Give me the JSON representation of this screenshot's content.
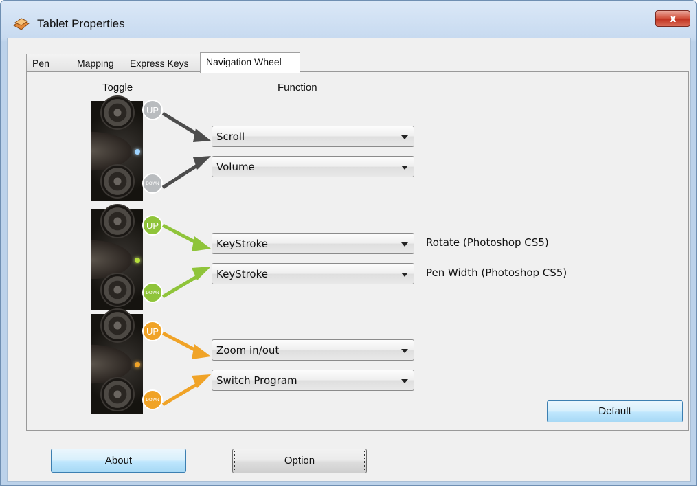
{
  "window": {
    "title": "Tablet Properties",
    "close_label": "x"
  },
  "tabs": [
    {
      "label": "Pen",
      "active": false
    },
    {
      "label": "Mapping",
      "active": false
    },
    {
      "label": "Express Keys",
      "active": false
    },
    {
      "label": "Navigation Wheel",
      "active": true
    }
  ],
  "headers": {
    "toggle": "Toggle",
    "function": "Function"
  },
  "groups": [
    {
      "color": "#b9bcbf",
      "up_label": "UP",
      "down_label": "DOWN",
      "functions": [
        {
          "value": "Scroll",
          "note": ""
        },
        {
          "value": "Volume",
          "note": ""
        }
      ]
    },
    {
      "color": "#8fc43a",
      "up_label": "UP",
      "down_label": "DOWN",
      "functions": [
        {
          "value": "KeyStroke",
          "note": "Rotate (Photoshop CS5)"
        },
        {
          "value": "KeyStroke",
          "note": "Pen Width (Photoshop CS5)"
        }
      ]
    },
    {
      "color": "#f0a327",
      "up_label": "UP",
      "down_label": "DOWN",
      "functions": [
        {
          "value": "Zoom in/out",
          "note": ""
        },
        {
          "value": "Switch Program",
          "note": ""
        }
      ]
    }
  ],
  "buttons": {
    "default": "Default",
    "about": "About",
    "option": "Option"
  }
}
